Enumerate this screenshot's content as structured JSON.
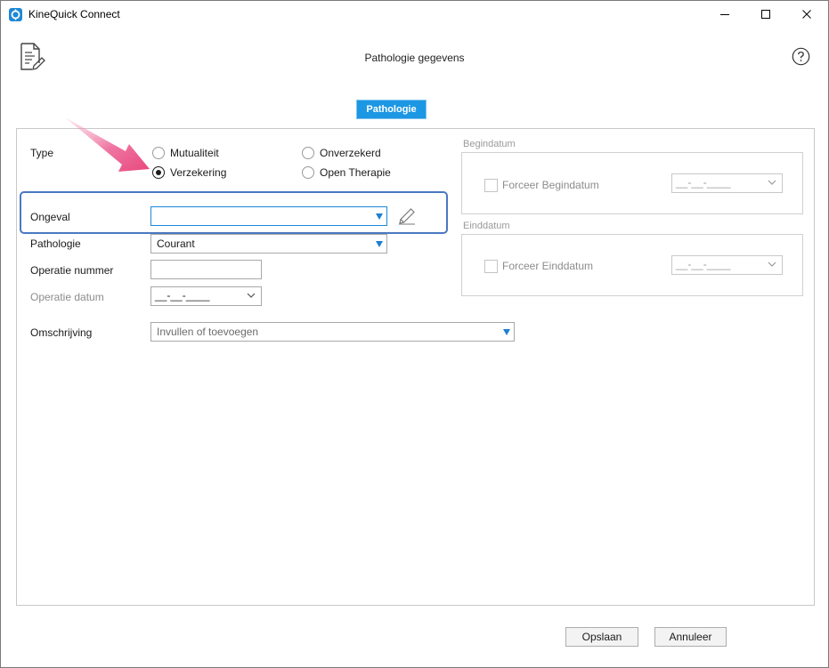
{
  "window": {
    "title": "KineQuick Connect",
    "icons": {
      "app": "app-logo-icon",
      "minimize": "minimize-icon",
      "maximize": "maximize-icon",
      "close": "close-icon"
    }
  },
  "header": {
    "title": "Pathologie gegevens",
    "document_icon": "document-edit-icon",
    "help_icon": "help-icon"
  },
  "tabs": [
    {
      "label": "Pathologie",
      "active": true
    }
  ],
  "form": {
    "type": {
      "label": "Type",
      "options": [
        {
          "label": "Mutualiteit",
          "checked": false
        },
        {
          "label": "Onverzekerd",
          "checked": false
        },
        {
          "label": "Verzekering",
          "checked": true
        },
        {
          "label": "Open Therapie",
          "checked": false
        }
      ]
    },
    "ongeval": {
      "label": "Ongeval",
      "value": "",
      "edit_icon": "pencil-icon"
    },
    "pathologie": {
      "label": "Pathologie",
      "value": "Courant"
    },
    "operatie_nummer": {
      "label": "Operatie nummer",
      "value": ""
    },
    "operatie_datum": {
      "label": "Operatie datum",
      "value": "__-__-____"
    },
    "omschrijving": {
      "label": "Omschrijving",
      "value": "Invullen of toevoegen"
    }
  },
  "begindatum": {
    "group_label": "Begindatum",
    "checkbox_label": "Forceer Begindatum",
    "checked": false,
    "date_value": "__-__-____"
  },
  "einddatum": {
    "group_label": "Einddatum",
    "checkbox_label": "Forceer Einddatum",
    "checked": false,
    "date_value": "__-__-____"
  },
  "footer": {
    "save_label": "Opslaan",
    "cancel_label": "Annuleer"
  },
  "colors": {
    "accent": "#1c97e3",
    "highlight": "#4a78c2",
    "annotation_arrow": "#e8467c"
  }
}
